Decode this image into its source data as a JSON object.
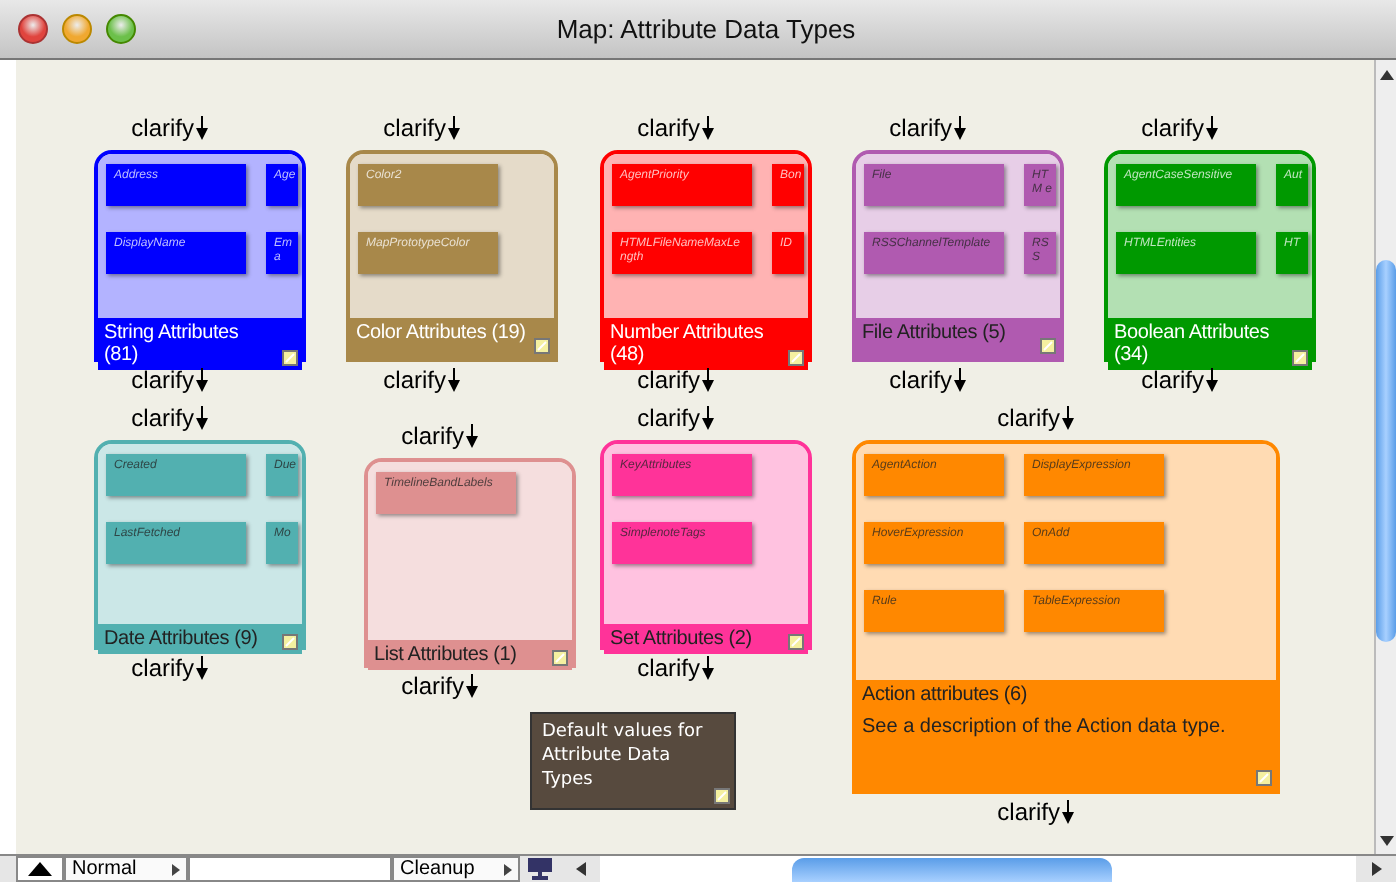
{
  "window": {
    "title": "Map: Attribute Data Types"
  },
  "nodes": [
    {
      "title": "String Attributes (81)",
      "color": "#0000ff",
      "light_text": true,
      "link_above": "clarify",
      "link_below": "clarify",
      "items": [
        {
          "label": "Address",
          "clipped": false
        },
        {
          "label": "Age",
          "clipped": true
        },
        {
          "label": "DisplayName",
          "clipped": false
        },
        {
          "label": "Ema",
          "clipped": true
        }
      ]
    },
    {
      "title": "Color Attributes (19)",
      "color": "#a8884a",
      "light_text": true,
      "link_above": "clarify",
      "link_below": "clarify",
      "items": [
        {
          "label": "Color2",
          "clipped": false
        },
        {
          "label": "MapPrototypeColor",
          "clipped": false
        }
      ]
    },
    {
      "title": "Number Attributes (48)",
      "color": "#ff0000",
      "light_text": true,
      "link_above": "clarify",
      "link_below": "clarify",
      "items": [
        {
          "label": "AgentPriority",
          "clipped": false
        },
        {
          "label": "Bon",
          "clipped": true
        },
        {
          "label": "HTMLFileNameMaxLength",
          "clipped": false
        },
        {
          "label": "ID",
          "clipped": true
        }
      ]
    },
    {
      "title": "File Attributes (5)",
      "color": "#b05ab0",
      "light_text": false,
      "link_above": "clarify",
      "link_below": "clarify",
      "items": [
        {
          "label": "File",
          "clipped": false
        },
        {
          "label": "HTM e",
          "clipped": true
        },
        {
          "label": "RSSChannelTemplate",
          "clipped": false
        },
        {
          "label": "RSS",
          "clipped": true
        }
      ]
    },
    {
      "title": "Boolean Attributes (34)",
      "color": "#009900",
      "light_text": true,
      "link_above": "clarify",
      "link_below": "clarify",
      "items": [
        {
          "label": "AgentCaseSensitive",
          "clipped": false
        },
        {
          "label": "Aut",
          "clipped": true
        },
        {
          "label": "HTMLEntities",
          "clipped": false
        },
        {
          "label": "HT",
          "clipped": true
        }
      ]
    },
    {
      "title": "Date Attributes (9)",
      "color": "#52b0b0",
      "light_text": false,
      "link_above": "clarify",
      "link_below": "clarify",
      "items": [
        {
          "label": "Created",
          "clipped": false
        },
        {
          "label": "Due",
          "clipped": true
        },
        {
          "label": "LastFetched",
          "clipped": false
        },
        {
          "label": "Mo",
          "clipped": true
        }
      ]
    },
    {
      "title": "List Attributes (1)",
      "color": "#de9090",
      "light_text": false,
      "link_above": "clarify",
      "link_below": "clarify",
      "items": [
        {
          "label": "TimelineBandLabels",
          "clipped": false
        }
      ]
    },
    {
      "title": "Set Attributes (2)",
      "color": "#ff3399",
      "light_text": false,
      "link_above": "clarify",
      "link_below": "clarify",
      "items": [
        {
          "label": "KeyAttributes",
          "clipped": false
        },
        {
          "label": "SimplenoteTags",
          "clipped": false
        }
      ]
    },
    {
      "title": "Action attributes (6)",
      "color": "#ff8800",
      "light_text": false,
      "link_above": "clarify",
      "link_below": "clarify",
      "description": "See a description of the Action data type.",
      "items": [
        {
          "label": "AgentAction",
          "clipped": false
        },
        {
          "label": "DisplayExpression",
          "clipped": false
        },
        {
          "label": "HoverExpression",
          "clipped": false
        },
        {
          "label": "OnAdd",
          "clipped": false
        },
        {
          "label": "Rule",
          "clipped": false
        },
        {
          "label": "TableExpression",
          "clipped": false
        }
      ]
    }
  ],
  "note": {
    "text": "Default values for Attribute Data Types",
    "color": "#574a3e"
  },
  "bottom_bar": {
    "view_mode": "Normal",
    "action": "Cleanup"
  }
}
